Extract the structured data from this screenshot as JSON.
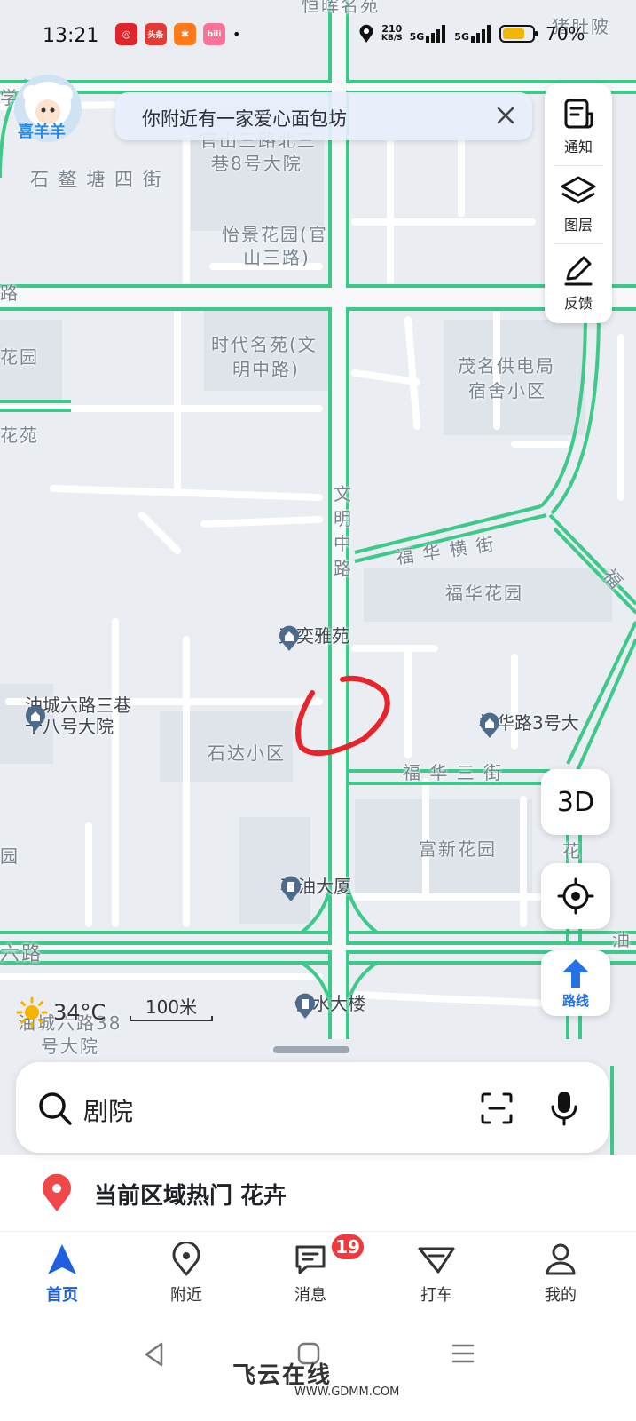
{
  "status_bar": {
    "time": "13:21",
    "app_icons": [
      {
        "name": "netease-music-icon",
        "color": "#e0242b",
        "glyph": "◎"
      },
      {
        "name": "toutiao-icon",
        "color": "#e53935",
        "glyph": "头条"
      },
      {
        "name": "app-orange-icon",
        "color": "#ff7a1a",
        "glyph": "✱"
      },
      {
        "name": "bilibili-icon",
        "color": "#fb7299",
        "glyph": "bili"
      }
    ],
    "dot": "•",
    "net_speed_value": "210",
    "net_speed_unit": "KB/S",
    "signal_1": "5G",
    "signal_2": "5G",
    "battery_percent": "70%"
  },
  "avatar": {
    "caption": "喜羊羊"
  },
  "notice": {
    "text": "你附近有一家爱心面包坊"
  },
  "side_panel": {
    "notify_label": "通知",
    "layers_label": "图层",
    "feedback_label": "反馈"
  },
  "map_labels": {
    "top_poi": "恒晖名苑",
    "top_right": "猪肚陂",
    "xue": "学",
    "guanshan_alley": "官山三路北三",
    "guanshan_alley2": "巷8号大院",
    "shiao": "石 鳌 塘 四 街",
    "yijing1": "怡景花园(官",
    "yijing2": "山三路)",
    "lu_left": "路",
    "huayuan_left": "花园",
    "shidai1": "时代名苑(文",
    "shidai2": "明中路)",
    "maoming1": "茂名供电局",
    "maoming2": "宿舍小区",
    "huayuan2_left": "花苑",
    "wenming": "文\n明\n中\n路",
    "fuhua_heng": "福 华 横 街",
    "fuhua_garden": "福华花园",
    "fu_right": "福",
    "shida": "石达小区",
    "fuhua_san": "福 华 三 街",
    "fuxin": "富新花园",
    "yuan_left": "园",
    "hua_right": "花",
    "liulu_left": "六路",
    "you_right": "油",
    "youcheng_bottom1": "油城六路38",
    "youcheng_bottom2": "号大院"
  },
  "map_pois": {
    "tianyi": "天奕雅苑",
    "youcheng_alley1": "油城六路三巷",
    "youcheng_alley2": "十八号大院",
    "fuhua_road": "福华路3号大",
    "shiyou": "石油大厦",
    "gongshui": "供水大楼"
  },
  "controls": {
    "btn_3d": "3D",
    "route_label": "路线"
  },
  "weather": {
    "temp": "34°C"
  },
  "scale": {
    "label": "100米"
  },
  "search": {
    "value": "剧院"
  },
  "hot_area": {
    "text": "当前区域热门 花卉"
  },
  "tabs": [
    {
      "label": "首页"
    },
    {
      "label": "附近"
    },
    {
      "label": "消息"
    },
    {
      "label": "打车"
    },
    {
      "label": "我的"
    }
  ],
  "messages_badge": "19",
  "watermark": {
    "text": "飞云在线",
    "url": "WWW.GDMM.COM"
  },
  "colors": {
    "road": "#3cc98a",
    "accent": "#2060e0",
    "badge": "#f0383d",
    "annotation": "#e8232a"
  }
}
